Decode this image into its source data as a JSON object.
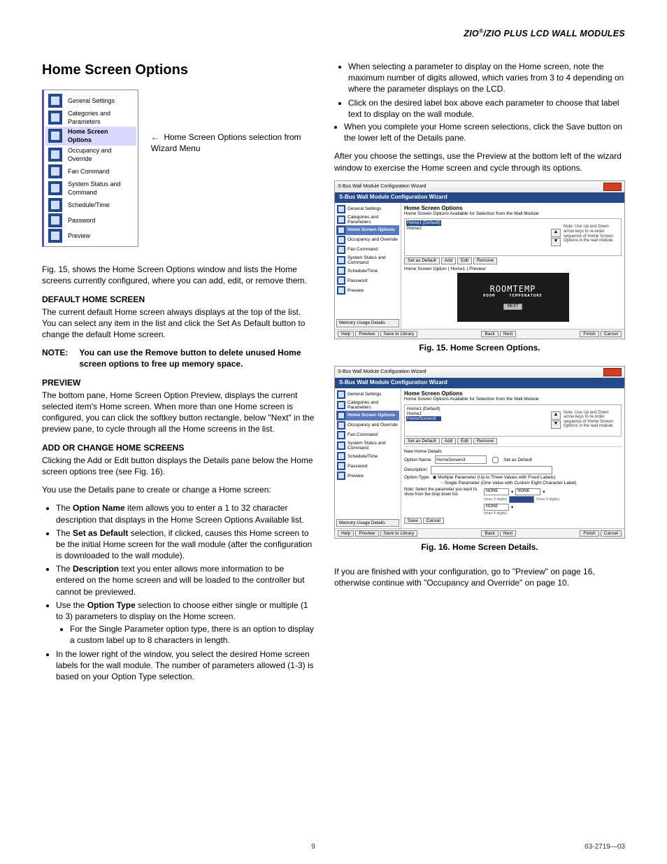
{
  "running_header": {
    "left": "ZIO",
    "sup": "®",
    "right": "/ZIO PLUS LCD WALL MODULES"
  },
  "title": "Home Screen Options",
  "wizard_menu": {
    "items": [
      "General Settings",
      "Categories and Parameters",
      "Home Screen Options",
      "Occupancy and Override",
      "Fan Command",
      "System Status and Command",
      "Schedule/Time",
      "Password",
      "Preview"
    ],
    "selected_index": 2,
    "arrow": "←",
    "note": "Home Screen Options selection from Wizard Menu"
  },
  "left_column": {
    "p1": "Fig. 15, shows the Home Screen Options window and lists the Home screens currently configured, where you can add, edit, or remove them.",
    "sub1_title": "DEFAULT HOME SCREEN",
    "sub1_body": "The current default Home screen always displays at the top of the list. You can select any item in the list and click the Set As Default button to change the default Home screen.",
    "note_label": "NOTE:",
    "note_body": "You can use the Remove button to delete unused Home screen options to free up memory space.",
    "sub2_title": "PREVIEW",
    "sub2_body": "The bottom pane, Home Screen Option Preview, displays the current selected item's Home screen. When more than one Home screen is configured, you can click the softkey button rectangle, below \"Next\" in the preview pane, to cycle through all the Home screens in the list.",
    "sub3_title": "ADD OR CHANGE HOME SCREENS",
    "sub3_intro": "Clicking the Add or Edit button displays the Details pane below the Home screen options tree (see Fig. 16).",
    "sub3_lead": "You use the Details pane to create or change a Home screen:",
    "bullets": [
      {
        "lead": "The ",
        "bold": "Option Name",
        "rest": " item allows you to enter a 1 to 32 character description that displays in the Home Screen Options Available list."
      },
      {
        "lead": "The ",
        "bold": "Set as Default",
        "rest": " selection, if clicked, causes this Home screen to be the initial Home screen for the wall module (after the configuration is downloaded to the wall module)."
      },
      {
        "lead": "The ",
        "bold": "Description",
        "rest": " text you enter allows more information to be entered on the home screen and will be loaded to the controller but cannot be previewed."
      },
      {
        "lead": "Use the ",
        "bold": "Option Type",
        "rest": " selection to choose either single or multiple (1 to 3) parameters to display on the Home screen.",
        "sub": [
          "For the Single Parameter option type, there is an option to display a custom label up to 8 characters in length."
        ]
      },
      {
        "lead": "",
        "bold": "",
        "rest": "In the lower right of the window, you select the desired Home screen labels for the wall module. The number of parameters allowed (1-3) is based on your Option Type selection."
      }
    ]
  },
  "right_column": {
    "top_bullets_a": [
      "When selecting a parameter to display on the Home screen, note the maximum number of digits allowed, which varies from 3 to 4 depending on where the parameter displays on the LCD.",
      "Click on the desired label box above each parameter to choose that label text to display on the wall module."
    ],
    "top_bullet_b": "When you complete your Home screen selections, click the Save button on the lower left of the Details pane.",
    "after_note": "After you choose the settings, use the Preview at the bottom left of the wizard window to exercise the Home screen and cycle through its options."
  },
  "shot_common": {
    "window_title": "S-Bus Wall Module Configuration Wizard",
    "banner": "S-Bus Wall Module Configuration Wizard",
    "nav": [
      "General Settings",
      "Categories and Parameters",
      "Home Screen Options",
      "Occupancy and Override",
      "Fan Command",
      "System Status and Command",
      "Schedule/Time",
      "Password",
      "Preview"
    ],
    "mem_btn": "Memory Usage Details",
    "main_title": "Home Screen Options",
    "main_desc": "Home Screen Options Available for Selection from the Wall Module",
    "list_note": "Note: Use Up and Down arrow keys to re-order sequence of Home Screen Options in the wall module.",
    "btn_setdef": "Set as Default",
    "btn_add": "Add",
    "btn_edit": "Edit",
    "btn_remove": "Remove",
    "footer_help": "Help",
    "footer_preview": "Preview",
    "footer_savelib": "Save to Library",
    "footer_back": "Back",
    "footer_next": "Next",
    "footer_finish": "Finish",
    "footer_cancel": "Cancel"
  },
  "shot15": {
    "list_items": [
      "Home1 (Default)",
      "Home2"
    ],
    "selected_index": 0,
    "preview_label": "Home Screen Option  ( Home1 ) Preview:",
    "lcd_main": "ROOMTEMP",
    "lcd_left": "ROOM",
    "lcd_right": "TEMPERATURE",
    "lcd_next": "NEXT",
    "caption": "Fig. 15. Home Screen Options."
  },
  "shot16": {
    "list_items": [
      "Home1 (Default)",
      "Home2",
      "HomeScreen3"
    ],
    "selected_index": 2,
    "details_title": "New Home Details",
    "opt_name_label": "Option Name:",
    "opt_name_value": "HomeScreen3",
    "set_default_label": "Set as Default",
    "desc_label": "Description:",
    "opt_type_label": "Option Type:",
    "radio_multi": "Multiple Parameter (Up to Three Values with Fixed Labels)",
    "radio_single": "Single Parameter (One Value with Custom Eight Character Label)",
    "lg_note": "Note: Select the parameter you want to show from the drop down list.",
    "slot_none": "NONE",
    "hint3": "(max 3 digits)",
    "hint4": "(max 4 digits)",
    "btn_save": "Save",
    "btn_cancel": "Cancel",
    "caption": "Fig. 16. Home Screen Details."
  },
  "closing": "If you are finished with your configuration, go to \"Preview\" on page 16, otherwise continue with \"Occupancy and Override\" on page 10.",
  "footer": {
    "page": "9",
    "doc": "63-2719—03"
  }
}
